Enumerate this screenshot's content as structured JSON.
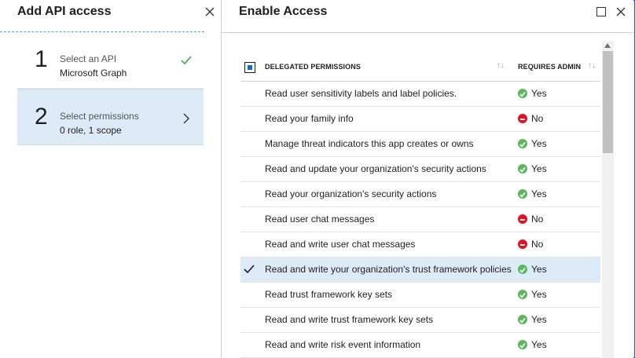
{
  "left_blade": {
    "title": "Add API access",
    "steps": [
      {
        "number": "1",
        "label": "Select an API",
        "value": "Microsoft Graph",
        "status": "complete"
      },
      {
        "number": "2",
        "label": "Select permissions",
        "value": "0 role, 1 scope",
        "status": "current"
      }
    ]
  },
  "right_blade": {
    "title": "Enable Access",
    "table": {
      "headers": {
        "permission": "DELEGATED PERMISSIONS",
        "admin": "REQUIRES ADMIN"
      },
      "rows": [
        {
          "name": "Read user sensitivity labels and label policies.",
          "admin": "Yes",
          "checked": false
        },
        {
          "name": "Read your family info",
          "admin": "No",
          "checked": false
        },
        {
          "name": "Manage threat indicators this app creates or owns",
          "admin": "Yes",
          "checked": false
        },
        {
          "name": "Read and update your organization's security actions",
          "admin": "Yes",
          "checked": false
        },
        {
          "name": "Read your organization's security actions",
          "admin": "Yes",
          "checked": false
        },
        {
          "name": "Read user chat messages",
          "admin": "No",
          "checked": false
        },
        {
          "name": "Read and write user chat messages",
          "admin": "No",
          "checked": false
        },
        {
          "name": "Read and write your organization's trust framework policies",
          "admin": "Yes",
          "checked": true
        },
        {
          "name": "Read trust framework key sets",
          "admin": "Yes",
          "checked": false
        },
        {
          "name": "Read and write trust framework key sets",
          "admin": "Yes",
          "checked": false
        },
        {
          "name": "Read and write risk event information",
          "admin": "Yes",
          "checked": false
        }
      ]
    }
  },
  "colors": {
    "accent": "#0a6fc7",
    "selected_bg": "#dcebf7",
    "yes": "#5cb85c",
    "no": "#e81123"
  }
}
